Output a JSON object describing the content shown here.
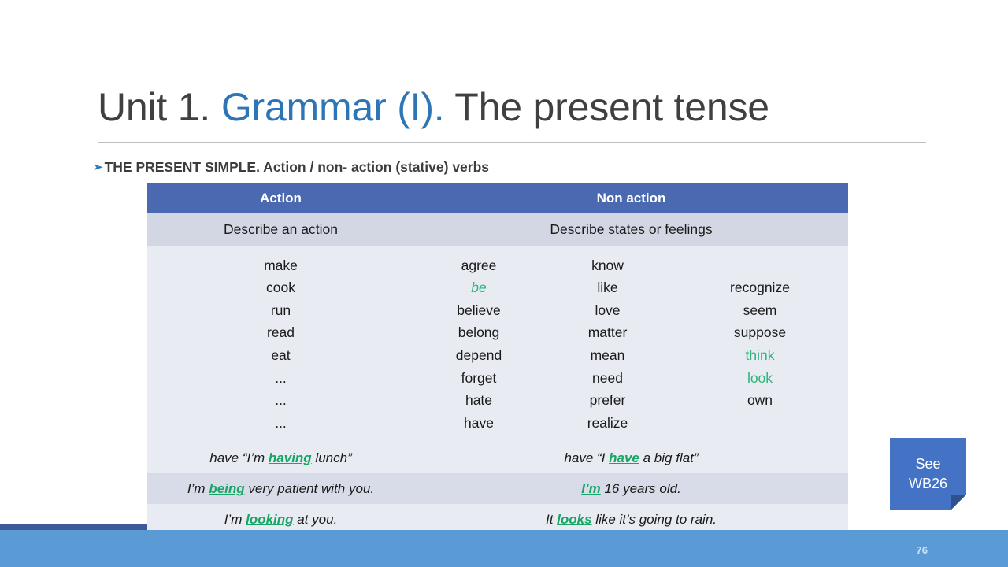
{
  "slide": {
    "title_prefix": "Unit 1. ",
    "title_accent": "Grammar (I).",
    "title_suffix": " The present tense",
    "bullet_arrow": "➢",
    "bullet_text": "THE PRESENT SIMPLE. Action / non- action (stative) verbs",
    "page_number": "76",
    "accent_color": "#2E75B6",
    "header_fill": "#4A69B0",
    "highlight_green": "#18A566",
    "footer_color": "#5B9BD5"
  },
  "table": {
    "headers": [
      {
        "label": "Action",
        "span": 1
      },
      {
        "label": "Non action",
        "span": 3
      }
    ],
    "subheaders": [
      {
        "label": "Describe an action",
        "span": 1
      },
      {
        "label": "Describe  states or feelings",
        "span": 3
      }
    ],
    "verb_columns": [
      {
        "name": "action-verbs",
        "verbs": [
          {
            "text": "make",
            "green": false
          },
          {
            "text": "cook",
            "green": false
          },
          {
            "text": "run",
            "green": false
          },
          {
            "text": "read",
            "green": false
          },
          {
            "text": "eat",
            "green": false
          },
          {
            "text": "...",
            "green": false
          },
          {
            "text": "...",
            "green": false
          },
          {
            "text": "...",
            "green": false
          }
        ]
      },
      {
        "name": "non-action-verbs-1",
        "verbs": [
          {
            "text": "agree",
            "green": false
          },
          {
            "text": "be",
            "green": true,
            "italic": true
          },
          {
            "text": "believe",
            "green": false
          },
          {
            "text": "belong",
            "green": false
          },
          {
            "text": "depend",
            "green": false
          },
          {
            "text": "forget",
            "green": false
          },
          {
            "text": "hate",
            "green": false
          },
          {
            "text": "have",
            "green": false
          }
        ]
      },
      {
        "name": "non-action-verbs-2",
        "verbs": [
          {
            "text": "know",
            "green": false
          },
          {
            "text": "like",
            "green": false
          },
          {
            "text": "love",
            "green": false
          },
          {
            "text": "matter",
            "green": false
          },
          {
            "text": "mean",
            "green": false
          },
          {
            "text": "need",
            "green": false
          },
          {
            "text": "prefer",
            "green": false
          },
          {
            "text": "realize",
            "green": false
          }
        ]
      },
      {
        "name": "non-action-verbs-3",
        "verbs": [
          {
            "text": "recognize",
            "green": false
          },
          {
            "text": "seem",
            "green": false
          },
          {
            "text": "suppose",
            "green": false
          },
          {
            "text": "think",
            "green": true,
            "italic": false
          },
          {
            "text": "look",
            "green": true,
            "italic": false
          },
          {
            "text": "own",
            "green": false
          }
        ]
      }
    ],
    "example_rows": [
      {
        "shade": "light",
        "action": {
          "pre": "have “I’m ",
          "hl": "having",
          "post": " lunch”"
        },
        "non_action": {
          "pre": "have “I ",
          "hl": "have",
          "post": " a big flat”"
        }
      },
      {
        "shade": "dark",
        "action": {
          "pre": "I’m ",
          "hl": "being",
          "post": " very patient with you."
        },
        "non_action": {
          "pre": "",
          "hl": "I’m",
          "post": " 16 years old."
        }
      },
      {
        "shade": "light",
        "action": {
          "pre": "I’m ",
          "hl": "looking",
          "post": " at you."
        },
        "non_action": {
          "pre": "It ",
          "hl": "looks",
          "post": " like it’s going to rain."
        }
      }
    ]
  },
  "see_note": {
    "line1": "See",
    "line2": "WB26",
    "fill": "#4472C4",
    "fold_fill": "#2F528F"
  }
}
